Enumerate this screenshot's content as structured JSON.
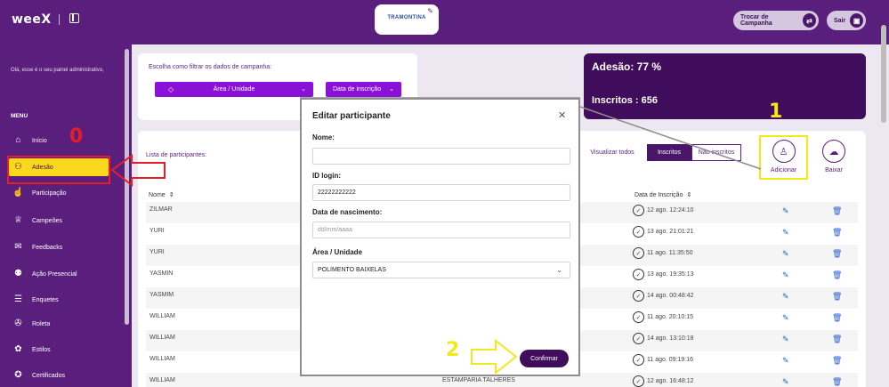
{
  "header": {
    "logo": "weeX",
    "brand": "TRAMONTINA",
    "trocar_label": "Trocar de Campanha",
    "sair_label": "Sair"
  },
  "sidebar": {
    "greeting": "Olá, esse é o seu painel administrativo,",
    "menu_title": "MENU",
    "items": [
      {
        "label": "Início",
        "icon": "home-icon"
      },
      {
        "label": "Adesão",
        "icon": "users-icon"
      },
      {
        "label": "Participação",
        "icon": "hand-icon"
      },
      {
        "label": "Campeões",
        "icon": "trophy-icon"
      },
      {
        "label": "Feedbacks",
        "icon": "chat-icon"
      },
      {
        "label": "Ação Presencial",
        "icon": "presence-icon"
      },
      {
        "label": "Enquetes",
        "icon": "poll-icon"
      },
      {
        "label": "Roleta",
        "icon": "wheel-icon"
      },
      {
        "label": "Estilos",
        "icon": "palette-icon"
      },
      {
        "label": "Certificados",
        "icon": "certificate-icon"
      }
    ]
  },
  "filter": {
    "label": "Escolha como filtrar os dados de campanha:",
    "area_select": "Área / Unidade",
    "date_select": "Data de inscrição"
  },
  "stats": {
    "adesao": "Adesão: 77 %",
    "inscritos": "Inscritos : 656"
  },
  "list": {
    "label": "Lista de participantes:",
    "toggle_all": "Visualizar todos",
    "toggle_inscritos": "Inscritos",
    "toggle_nao": "Não inscritos",
    "add_label": "Adicionar",
    "download_label": "Baixar",
    "col_name": "Nome",
    "col_date": "Data de Inscrição",
    "rows": [
      {
        "name": "ZILMAR",
        "area": "",
        "date": "12 ago. 12:24:10"
      },
      {
        "name": "YURI",
        "area": "",
        "date": "13 ago. 21:01:21"
      },
      {
        "name": "YURI",
        "area": "",
        "date": "11 ago. 11:35:50"
      },
      {
        "name": "YASMIN",
        "area": "",
        "date": "13 ago. 19:35:13"
      },
      {
        "name": "YASMIM",
        "area": "",
        "date": "14 ago. 00:48:42"
      },
      {
        "name": "WILLIAM",
        "area": "",
        "date": "11 ago. 20:10:15"
      },
      {
        "name": "WILLIAM",
        "area": "",
        "date": "14 ago. 13:10:18"
      },
      {
        "name": "WILLIAM",
        "area": "",
        "date": "11 ago. 09:19:16"
      },
      {
        "name": "WILLIAM",
        "area": "ESTAMPARIA TALHERES",
        "date": "12 ago. 16:48:12"
      }
    ]
  },
  "modal": {
    "title": "Editar participante",
    "name_label": "Nome:",
    "name_value": "",
    "id_label": "ID login:",
    "id_value": "22222222222",
    "birth_label": "Data de nascimento:",
    "birth_placeholder": "dd/mm/aaaa",
    "area_label": "Área / Unidade",
    "area_value": "POLIMENTO BAIXELAS",
    "confirm_label": "Confirmar"
  },
  "annotations": {
    "step0": "0",
    "step1": "1",
    "step2": "2",
    "red": "#e41e26",
    "yellow": "#f5e81a"
  }
}
